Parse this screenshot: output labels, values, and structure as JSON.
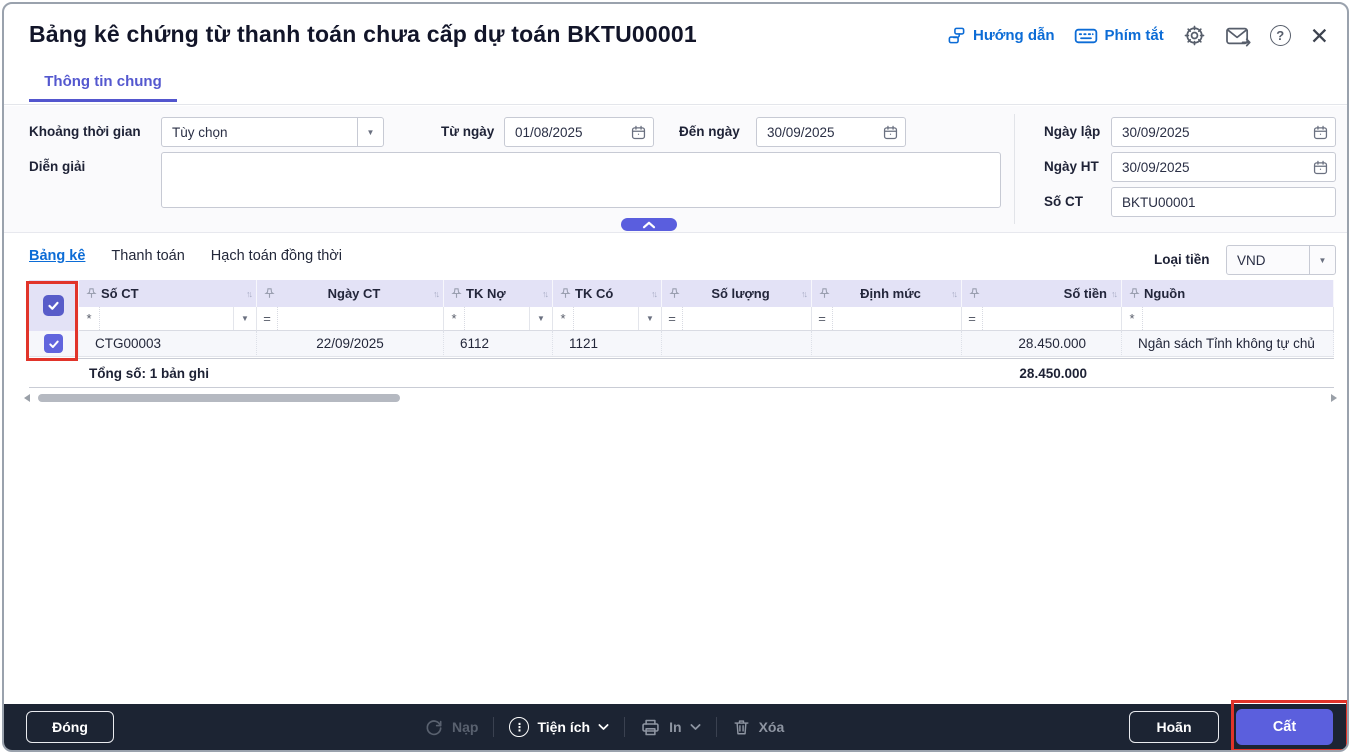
{
  "header": {
    "title": "Bảng kê chứng từ thanh toán chưa cấp dự toán BKTU00001",
    "guide_label": "Hướng dẫn",
    "shortcut_label": "Phím tắt",
    "tab_label": "Thông tin chung"
  },
  "form": {
    "period_label": "Khoảng thời gian",
    "period_value": "Tùy chọn",
    "from_label": "Từ ngày",
    "from_value": "01/08/2025",
    "to_label": "Đến ngày",
    "to_value": "30/09/2025",
    "description_label": "Diễn giải",
    "description_value": "",
    "created_date_label": "Ngày lập",
    "created_date_value": "30/09/2025",
    "posting_date_label": "Ngày HT",
    "posting_date_value": "30/09/2025",
    "doc_number_label": "Số CT",
    "doc_number_value": "BKTU00001"
  },
  "detail": {
    "tabs": [
      {
        "label": "Bảng kê"
      },
      {
        "label": "Thanh toán"
      },
      {
        "label": "Hạch toán đồng thời"
      }
    ],
    "currency_label": "Loại tiền",
    "currency_value": "VND"
  },
  "table": {
    "columns": [
      {
        "label": "Số CT",
        "filter_op": "*"
      },
      {
        "label": "Ngày CT",
        "filter_op": "="
      },
      {
        "label": "TK Nợ",
        "filter_op": "*"
      },
      {
        "label": "TK Có",
        "filter_op": "*"
      },
      {
        "label": "Số lượng",
        "filter_op": "="
      },
      {
        "label": "Định mức",
        "filter_op": "="
      },
      {
        "label": "Số tiền",
        "filter_op": "="
      },
      {
        "label": "Nguồn",
        "filter_op": "*"
      }
    ],
    "rows": [
      {
        "so_ct": "CTG00003",
        "ngay_ct": "22/09/2025",
        "tk_no": "6112",
        "tk_co": "1121",
        "so_luong": "",
        "dinh_muc": "",
        "so_tien": "28.450.000",
        "nguon": "Ngân sách Tỉnh không tự chủ"
      }
    ],
    "summary": {
      "label": "Tổng số:",
      "count": "1",
      "suffix": "bản ghi",
      "amount": "28.450.000"
    }
  },
  "footer": {
    "close_label": "Đóng",
    "refresh_label": "Nạp",
    "utilities_label": "Tiện ích",
    "print_label": "In",
    "delete_label": "Xóa",
    "postpone_label": "Hoãn",
    "save_label": "Cất"
  },
  "colors": {
    "accent_purple": "#5b5fdd",
    "link_blue": "#0c6cd6",
    "table_header_bg": "#e3e2f6",
    "footer_bg": "#1c2433",
    "annotation_red": "#e1342a"
  }
}
